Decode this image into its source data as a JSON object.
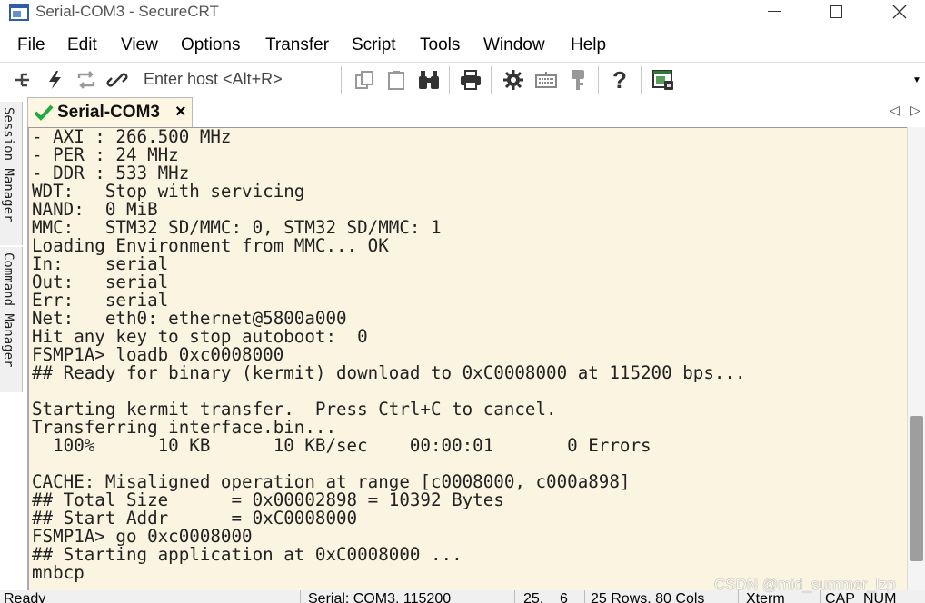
{
  "window": {
    "title": "Serial-COM3 - SecureCRT"
  },
  "menu": [
    "File",
    "Edit",
    "View",
    "Options",
    "Transfer",
    "Script",
    "Tools",
    "Window",
    "Help"
  ],
  "toolbar": {
    "host_placeholder": "Enter host <Alt+R>",
    "icons": [
      "connect-icon",
      "quick-connect-icon",
      "reconnect-icon",
      "disconnect-icon",
      "copy-icon",
      "paste-icon",
      "find-icon",
      "print-icon",
      "settings-icon",
      "keymap-icon",
      "key-icon",
      "help-icon",
      "sftp-icon"
    ]
  },
  "side_panels": {
    "session_manager": "Session Manager",
    "command_manager": "Command Manager"
  },
  "tab": {
    "label": "Serial-COM3",
    "close": "×",
    "status_color": "#1eaa3c"
  },
  "terminal": {
    "lines": [
      "- AXI : 266.500 MHz",
      "- PER : 24 MHz",
      "- DDR : 533 MHz",
      "WDT:   Stop with servicing",
      "NAND:  0 MiB",
      "MMC:   STM32 SD/MMC: 0, STM32 SD/MMC: 1",
      "Loading Environment from MMC... OK",
      "In:    serial",
      "Out:   serial",
      "Err:   serial",
      "Net:   eth0: ethernet@5800a000",
      "Hit any key to stop autoboot:  0",
      "FSMP1A> loadb 0xc0008000",
      "## Ready for binary (kermit) download to 0xC0008000 at 115200 bps...",
      "",
      "Starting kermit transfer.  Press Ctrl+C to cancel.",
      "Transferring interface.bin...",
      "  100%      10 KB      10 KB/sec    00:00:01       0 Errors",
      "",
      "CACHE: Misaligned operation at range [c0008000, c000a898]",
      "## Total Size      = 0x00002898 = 10392 Bytes",
      "## Start Addr      = 0xC0008000",
      "FSMP1A> go 0xc0008000",
      "## Starting application at 0xC0008000 ...",
      "mnbcp"
    ],
    "background": "#fbf4e1"
  },
  "statusbar": {
    "ready": "Ready",
    "connection": "Serial: COM3, 115200",
    "row": "25,",
    "col": "6",
    "size": "25 Rows, 80 Cols",
    "emulation": "Xterm",
    "cap": "CAP",
    "num": "NUM"
  },
  "watermark": "CSDN @mid_summer_lzp"
}
